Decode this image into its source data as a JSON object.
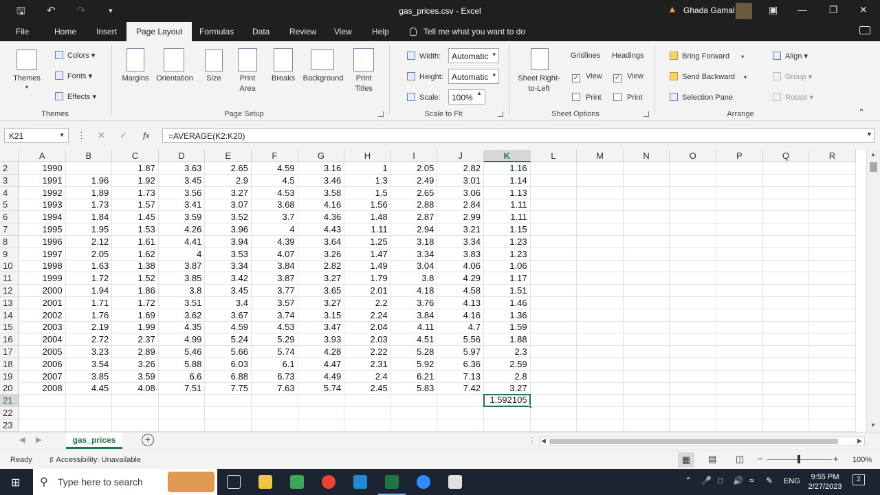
{
  "window": {
    "title": "gas_prices.csv  -  Excel",
    "user": "Ghada Gamal"
  },
  "menu": {
    "tabs": [
      "File",
      "Home",
      "Insert",
      "Page Layout",
      "Formulas",
      "Data",
      "Review",
      "View",
      "Help"
    ],
    "active_tab": "Page Layout",
    "tell_me": "Tell me what you want to do"
  },
  "ribbon": {
    "themes": {
      "themes": "Themes",
      "colors": "Colors",
      "fonts": "Fonts",
      "effects": "Effects",
      "group": "Themes"
    },
    "page_setup": {
      "margins": "Margins",
      "orientation": "Orientation",
      "size": "Size",
      "print_area_1": "Print",
      "print_area_2": "Area",
      "breaks": "Breaks",
      "background": "Background",
      "print_titles_1": "Print",
      "print_titles_2": "Titles",
      "group": "Page Setup"
    },
    "scale": {
      "width_label": "Width:",
      "width_value": "Automatic",
      "height_label": "Height:",
      "height_value": "Automatic",
      "scale_label": "Scale:",
      "scale_value": "100%",
      "group": "Scale to Fit"
    },
    "sheet_options": {
      "rtl_1": "Sheet Right-",
      "rtl_2": "to-Left",
      "gridlines": "Gridlines",
      "headings": "Headings",
      "view": "View",
      "print": "Print",
      "group": "Sheet Options"
    },
    "arrange": {
      "bring_forward": "Bring Forward",
      "send_backward": "Send Backward",
      "selection_pane": "Selection Pane",
      "align": "Align",
      "group_btn": "Group",
      "rotate": "Rotate",
      "group": "Arrange"
    }
  },
  "formula_bar": {
    "name_box": "K21",
    "formula": "=AVERAGE(K2:K20)"
  },
  "grid": {
    "columns": [
      "A",
      "B",
      "C",
      "D",
      "E",
      "F",
      "G",
      "H",
      "I",
      "J",
      "K",
      "L",
      "M",
      "N",
      "O",
      "P",
      "Q",
      "R"
    ],
    "row_numbers": [
      "2",
      "3",
      "4",
      "5",
      "6",
      "7",
      "8",
      "9",
      "10",
      "11",
      "12",
      "13",
      "14",
      "15",
      "16",
      "17",
      "18",
      "19",
      "20",
      "21",
      "22",
      "23"
    ],
    "rows": [
      [
        "1990",
        "",
        "1.87",
        "3.63",
        "2.65",
        "4.59",
        "3.16",
        "1",
        "2.05",
        "2.82",
        "1.16"
      ],
      [
        "1991",
        "1.96",
        "1.92",
        "3.45",
        "2.9",
        "4.5",
        "3.46",
        "1.3",
        "2.49",
        "3.01",
        "1.14"
      ],
      [
        "1992",
        "1.89",
        "1.73",
        "3.56",
        "3.27",
        "4.53",
        "3.58",
        "1.5",
        "2.65",
        "3.06",
        "1.13"
      ],
      [
        "1993",
        "1.73",
        "1.57",
        "3.41",
        "3.07",
        "3.68",
        "4.16",
        "1.56",
        "2.88",
        "2.84",
        "1.11"
      ],
      [
        "1994",
        "1.84",
        "1.45",
        "3.59",
        "3.52",
        "3.7",
        "4.36",
        "1.48",
        "2.87",
        "2.99",
        "1.11"
      ],
      [
        "1995",
        "1.95",
        "1.53",
        "4.26",
        "3.96",
        "4",
        "4.43",
        "1.11",
        "2.94",
        "3.21",
        "1.15"
      ],
      [
        "1996",
        "2.12",
        "1.61",
        "4.41",
        "3.94",
        "4.39",
        "3.64",
        "1.25",
        "3.18",
        "3.34",
        "1.23"
      ],
      [
        "1997",
        "2.05",
        "1.62",
        "4",
        "3.53",
        "4.07",
        "3.26",
        "1.47",
        "3.34",
        "3.83",
        "1.23"
      ],
      [
        "1998",
        "1.63",
        "1.38",
        "3.87",
        "3.34",
        "3.84",
        "2.82",
        "1.49",
        "3.04",
        "4.06",
        "1.06"
      ],
      [
        "1999",
        "1.72",
        "1.52",
        "3.85",
        "3.42",
        "3.87",
        "3.27",
        "1.79",
        "3.8",
        "4.29",
        "1.17"
      ],
      [
        "2000",
        "1.94",
        "1.86",
        "3.8",
        "3.45",
        "3.77",
        "3.65",
        "2.01",
        "4.18",
        "4.58",
        "1.51"
      ],
      [
        "2001",
        "1.71",
        "1.72",
        "3.51",
        "3.4",
        "3.57",
        "3.27",
        "2.2",
        "3.76",
        "4.13",
        "1.46"
      ],
      [
        "2002",
        "1.76",
        "1.69",
        "3.62",
        "3.67",
        "3.74",
        "3.15",
        "2.24",
        "3.84",
        "4.16",
        "1.36"
      ],
      [
        "2003",
        "2.19",
        "1.99",
        "4.35",
        "4.59",
        "4.53",
        "3.47",
        "2.04",
        "4.11",
        "4.7",
        "1.59"
      ],
      [
        "2004",
        "2.72",
        "2.37",
        "4.99",
        "5.24",
        "5.29",
        "3.93",
        "2.03",
        "4.51",
        "5.56",
        "1.88"
      ],
      [
        "2005",
        "3.23",
        "2.89",
        "5.46",
        "5.66",
        "5.74",
        "4.28",
        "2.22",
        "5.28",
        "5.97",
        "2.3"
      ],
      [
        "2006",
        "3.54",
        "3.26",
        "5.88",
        "6.03",
        "6.1",
        "4.47",
        "2.31",
        "5.92",
        "6.36",
        "2.59"
      ],
      [
        "2007",
        "3.85",
        "3.59",
        "6.6",
        "6.88",
        "6.73",
        "4.49",
        "2.4",
        "6.21",
        "7.13",
        "2.8"
      ],
      [
        "2008",
        "4.45",
        "4.08",
        "7.51",
        "7.75",
        "7.63",
        "5.74",
        "2.45",
        "5.83",
        "7.42",
        "3.27"
      ]
    ],
    "active_cell_value": "1.592105",
    "selected_column": "K",
    "selected_row": "21"
  },
  "sheet_tab": "gas_prices",
  "status": {
    "ready": "Ready",
    "accessibility": "Accessibility: Unavailable",
    "zoom": "100%"
  },
  "taskbar": {
    "search_placeholder": "Type here to search",
    "language": "ENG",
    "time": "9:55 PM",
    "date": "2/27/2023",
    "notifications": "2"
  },
  "colors": {
    "excel_green": "#217346",
    "titlebar": "#1f1f1f",
    "ribbon_bg": "#f3f3f3",
    "taskbar": "#1c2432"
  }
}
